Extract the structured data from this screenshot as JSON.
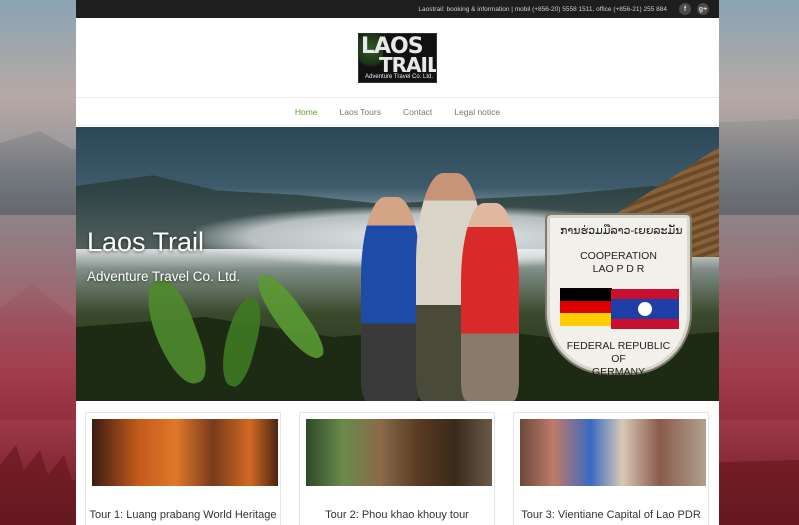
{
  "topbar": {
    "info": "Laostrail: booking & information | mobil (+856-20) 5558 1511, office (+856-21) 255 884",
    "social": [
      {
        "icon": "facebook-icon",
        "glyph": "f"
      },
      {
        "icon": "google-plus-icon",
        "glyph": "g+"
      }
    ]
  },
  "logo": {
    "line1": "LAOS",
    "line2": "TRAIL",
    "line3": "Adventure Travel Co. Ltd."
  },
  "nav": {
    "items": [
      {
        "label": "Home",
        "active": true
      },
      {
        "label": "Laos Tours",
        "active": false
      },
      {
        "label": "Contact",
        "active": false
      },
      {
        "label": "Legal notice",
        "active": false
      }
    ]
  },
  "hero": {
    "title": "Laos Trail",
    "subtitle": "Adventure Travel Co. Ltd."
  },
  "sign": {
    "lao_text": "ການຮ່ວມມືລາວ-ເຍຍລະມັນ",
    "coop1": "COOPERATION",
    "coop2": "LAO P D R",
    "fed1": "FEDERAL REPUBLIC",
    "fed2": "OF",
    "fed3": "GERMANY"
  },
  "tours": [
    {
      "title": "Tour 1: Luang prabang World Heritage"
    },
    {
      "title": "Tour 2: Phou khao khouy tour"
    },
    {
      "title": "Tour 3: Vientiane Capital of Lao PDR"
    }
  ],
  "colors": {
    "accent": "#5aa02c",
    "topbar_bg": "#1e1e1e"
  }
}
